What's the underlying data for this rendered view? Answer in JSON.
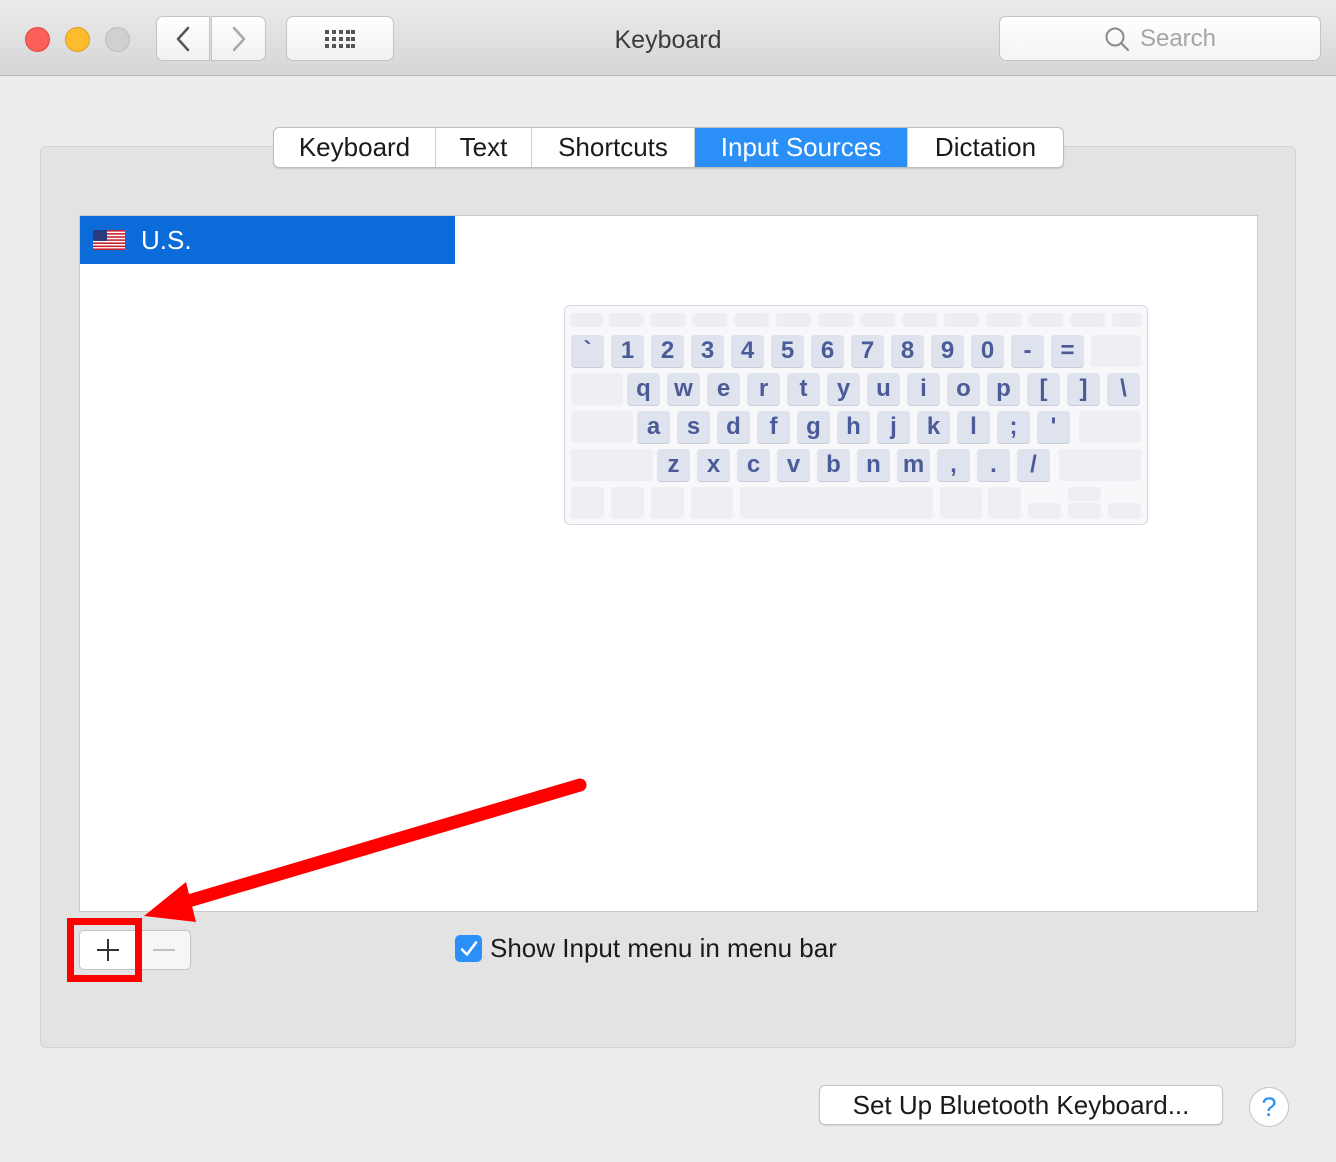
{
  "window": {
    "title": "Keyboard"
  },
  "search": {
    "placeholder": "Search"
  },
  "tabs": [
    {
      "label": "Keyboard",
      "active": false
    },
    {
      "label": "Text",
      "active": false
    },
    {
      "label": "Shortcuts",
      "active": false
    },
    {
      "label": "Input Sources",
      "active": true
    },
    {
      "label": "Dictation",
      "active": false
    }
  ],
  "input_sources": [
    {
      "label": "U.S.",
      "flag": "us-flag-icon",
      "selected": true
    }
  ],
  "keyboard_layout": {
    "row1": [
      "`",
      "1",
      "2",
      "3",
      "4",
      "5",
      "6",
      "7",
      "8",
      "9",
      "0",
      "-",
      "="
    ],
    "row2": [
      "q",
      "w",
      "e",
      "r",
      "t",
      "y",
      "u",
      "i",
      "o",
      "p",
      "[",
      "]",
      "\\"
    ],
    "row3": [
      "a",
      "s",
      "d",
      "f",
      "g",
      "h",
      "j",
      "k",
      "l",
      ";",
      "'"
    ],
    "row4": [
      "z",
      "x",
      "c",
      "v",
      "b",
      "n",
      "m",
      ",",
      ".",
      "/"
    ]
  },
  "controls": {
    "show_input_menu_label": "Show Input menu in menu bar",
    "show_input_menu_checked": true,
    "bluetooth_button_label": "Set Up Bluetooth Keyboard...",
    "help_label": "?"
  },
  "colors": {
    "accent": "#2a8ff7",
    "selection": "#0b6bd9",
    "annotation": "#ff0000"
  }
}
